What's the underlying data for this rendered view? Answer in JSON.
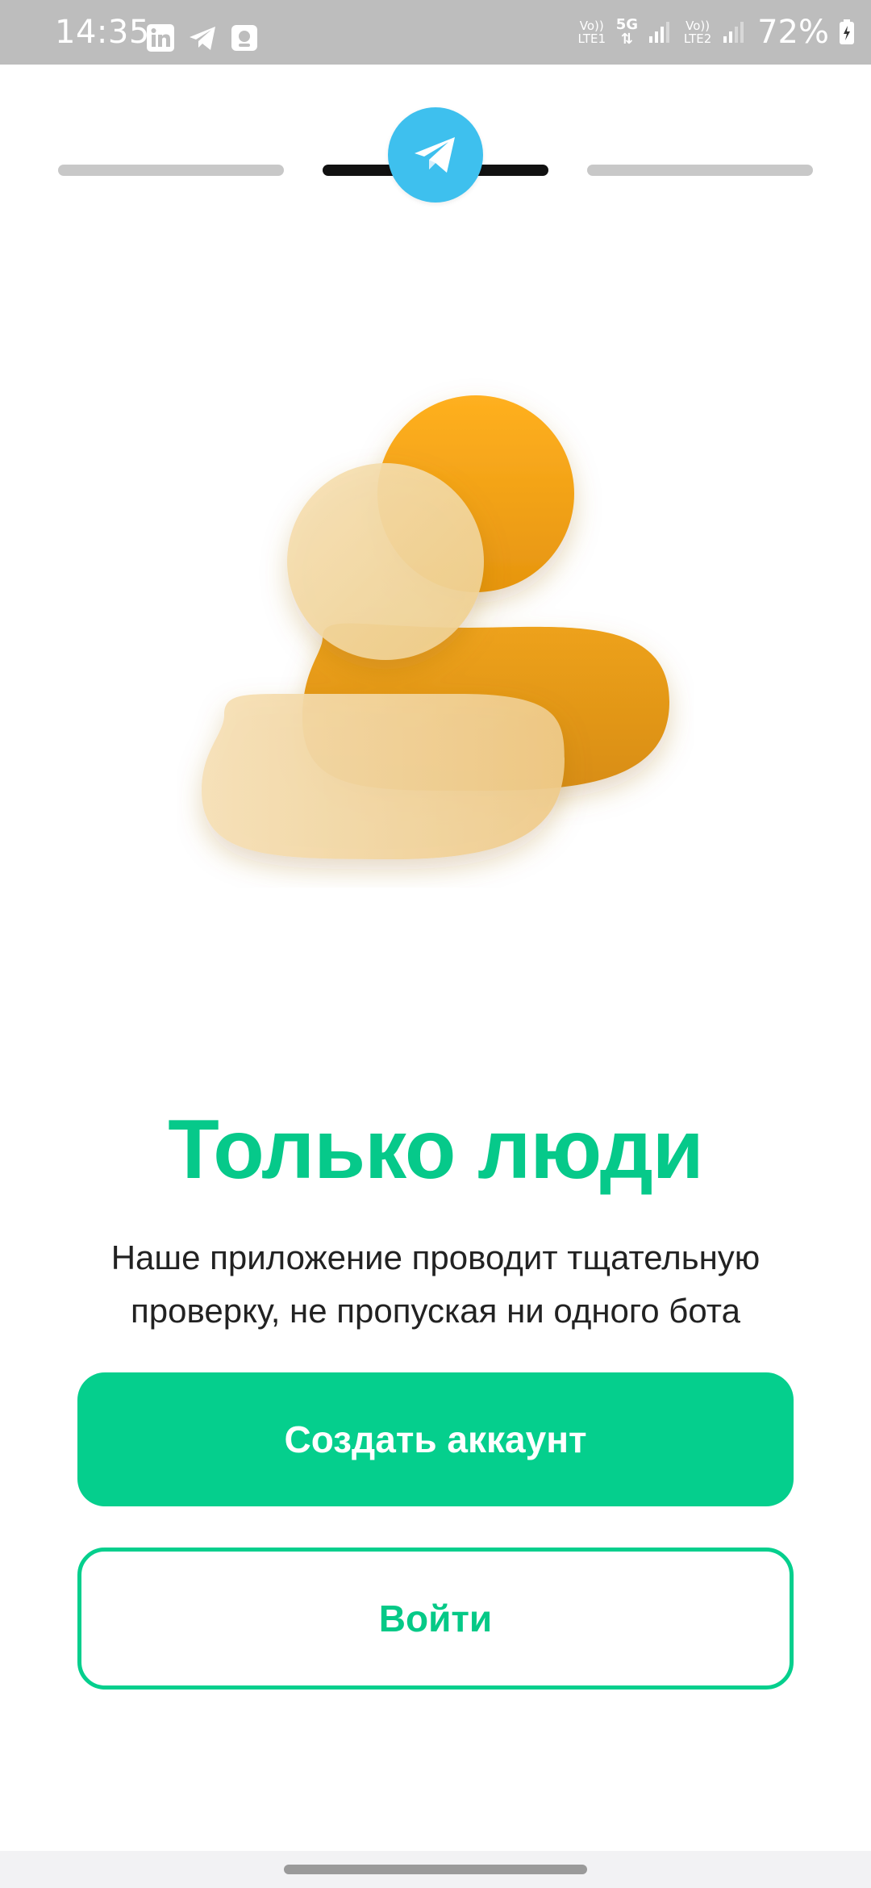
{
  "status_bar": {
    "time": "14:35",
    "left_icons": [
      "linkedin-icon",
      "telegram-icon",
      "notes-icon"
    ],
    "sim1_label": "Vo)) LTE1",
    "network_label": "5G",
    "sim2_label": "Vo)) LTE2",
    "battery_percent": "72%"
  },
  "onboarding": {
    "progress_steps": 3,
    "active_step": 2
  },
  "content": {
    "title": "Только люди",
    "subtitle": "Наше приложение проводит тщательную проверку, не пропуская ни одного бота"
  },
  "actions": {
    "create_account_label": "Создать аккаунт",
    "login_label": "Войти"
  },
  "colors": {
    "accent": "#05cf8d",
    "telegram": "#3ec0ee",
    "orange": "#f7a520",
    "peach": "#f4d49a"
  }
}
